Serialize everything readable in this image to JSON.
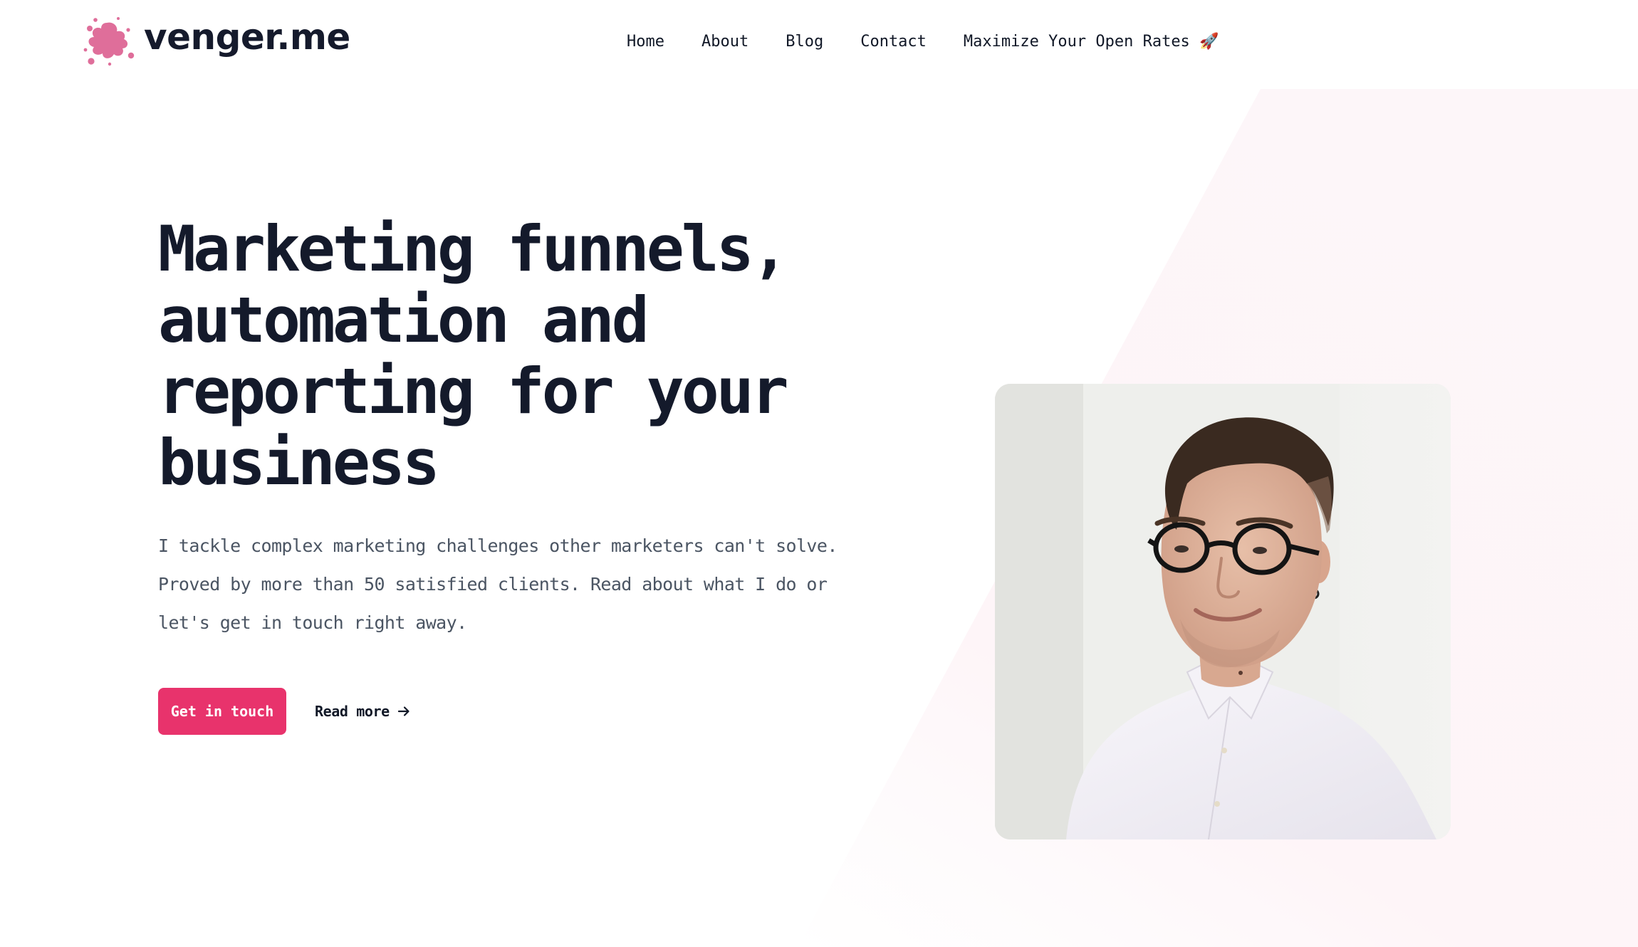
{
  "brand": {
    "name": "venger.me",
    "logo_icon": "paint-splash-icon",
    "accent_color": "#e8336c"
  },
  "nav": {
    "items": [
      {
        "label": "Home"
      },
      {
        "label": "About"
      },
      {
        "label": "Blog"
      },
      {
        "label": "Contact"
      },
      {
        "label": "Maximize Your Open Rates 🚀"
      }
    ]
  },
  "hero": {
    "title": "Marketing funnels, automation and reporting for your business",
    "description": "I tackle complex marketing challenges other marketers can't solve. Proved by more than 50 satisfied clients. Read about what I do or let's get in touch right away.",
    "primary_button": "Get in touch",
    "secondary_link": "Read more",
    "secondary_icon": "arrow-right-icon"
  },
  "portrait": {
    "subject": "portrait-photo"
  }
}
